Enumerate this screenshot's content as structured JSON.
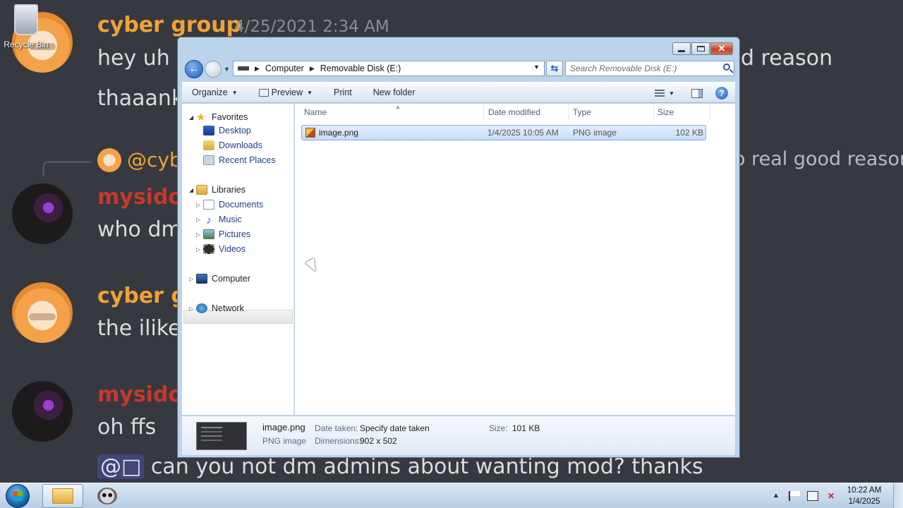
{
  "desktop": {
    "recycle_bin_label": "Recycle Bin"
  },
  "chat": {
    "msg1": {
      "user": "cyber group",
      "time": "4/25/2021 2:34 AM",
      "line1": "hey uh c",
      "line1_right": "d reason",
      "line2": "thaaank"
    },
    "reply": {
      "user": "@cyb",
      "text": "o real good reason"
    },
    "msg2": {
      "user": "mysidots",
      "line1": "who dm"
    },
    "msg3": {
      "user": "cyber g",
      "line1": "the ilike"
    },
    "msg4": {
      "user": "mysidots",
      "line1": "oh ffs",
      "mention": "@□",
      "line2": " can you not dm admins about wanting mod? thanks"
    }
  },
  "explorer": {
    "address": {
      "crumbs": [
        "Computer",
        "Removable Disk (E:)"
      ]
    },
    "search_placeholder": "Search Removable Disk (E:)",
    "toolbar": {
      "organize": "Organize",
      "preview": "Preview",
      "print": "Print",
      "new_folder": "New folder"
    },
    "nav": {
      "favorites": "Favorites",
      "desktop": "Desktop",
      "downloads": "Downloads",
      "recent_places": "Recent Places",
      "libraries": "Libraries",
      "documents": "Documents",
      "music": "Music",
      "pictures": "Pictures",
      "videos": "Videos",
      "computer": "Computer",
      "network": "Network"
    },
    "columns": {
      "name": "Name",
      "date_modified": "Date modified",
      "type": "Type",
      "size": "Size"
    },
    "files": [
      {
        "name": "image.png",
        "date_modified": "1/4/2025 10:05 AM",
        "type": "PNG image",
        "size": "102 KB"
      }
    ],
    "details": {
      "name": "image.png",
      "type": "PNG image",
      "date_taken_label": "Date taken:",
      "date_taken_value": "Specify date taken",
      "dimensions_label": "Dimensions:",
      "dimensions_value": "902 x 502",
      "size_label": "Size:",
      "size_value": "101 KB"
    }
  },
  "taskbar": {
    "time": "10:22 AM",
    "date": "1/4/2025",
    "tray_chevron": "▲"
  }
}
